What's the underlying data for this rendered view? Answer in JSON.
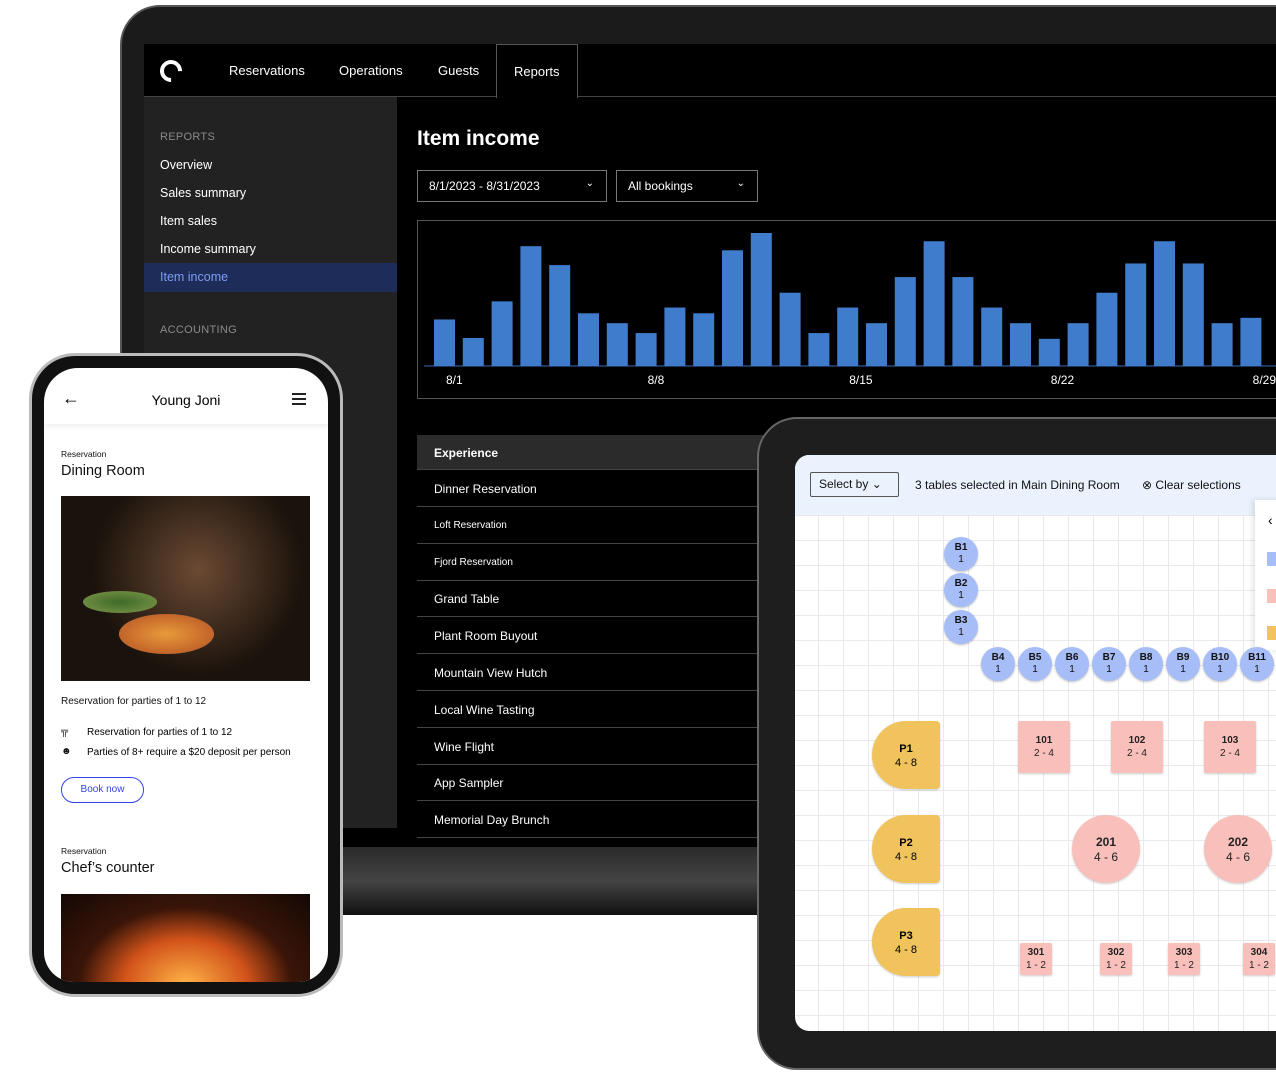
{
  "laptop": {
    "nav": {
      "logo": "logo-icon",
      "items": [
        "Reservations",
        "Operations",
        "Guests",
        "Reports"
      ],
      "active": "Reports"
    },
    "sidebar": {
      "sections": [
        {
          "heading": "REPORTS",
          "items": [
            "Overview",
            "Sales summary",
            "Item sales",
            "Income summary",
            "Item income"
          ]
        },
        {
          "heading": "ACCOUNTING",
          "items": []
        }
      ],
      "selected": "Item income",
      "selected_color": "#1e2c5a"
    },
    "page_title": "Item income",
    "date_range": "8/1/2023 - 8/31/2023",
    "booking_filter": "All bookings",
    "table": {
      "header": "Experience",
      "rows": [
        "Dinner Reservation",
        "Loft Reservation",
        "Fjord Reservation",
        "Grand Table",
        "Plant Room Buyout",
        "Mountain View Hutch",
        "Local Wine Tasting",
        "Wine Flight",
        "App Sampler",
        "Memorial Day Brunch"
      ]
    }
  },
  "chart_data": {
    "type": "bar",
    "title": "",
    "xlabel": "",
    "ylabel": "",
    "bar_color": "#3f7dcc",
    "categories": [
      "8/1",
      "8/2",
      "8/3",
      "8/4",
      "8/5",
      "8/6",
      "8/7",
      "8/8",
      "8/9",
      "8/10",
      "8/11",
      "8/12",
      "8/13",
      "8/14",
      "8/15",
      "8/16",
      "8/17",
      "8/18",
      "8/19",
      "8/20",
      "8/21",
      "8/22",
      "8/23",
      "8/24",
      "8/25",
      "8/26",
      "8/27",
      "8/28",
      "8/29"
    ],
    "tick_labels": [
      "8/1",
      "8/8",
      "8/15",
      "8/22",
      "8/29"
    ],
    "values": [
      113,
      68,
      157,
      291,
      245,
      128,
      104,
      80,
      142,
      128,
      281,
      323,
      178,
      80,
      142,
      104,
      216,
      303,
      216,
      142,
      104,
      66,
      104,
      178,
      249,
      303,
      249,
      104,
      117
    ],
    "grid": false
  },
  "tablet": {
    "select_label": "Select by",
    "status": "3 tables selected in Main Dining Room",
    "clear_label": "Clear selections",
    "bar_seats": [
      {
        "id": "B1",
        "cap": "1"
      },
      {
        "id": "B2",
        "cap": "1"
      },
      {
        "id": "B3",
        "cap": "1"
      },
      {
        "id": "B4",
        "cap": "1"
      },
      {
        "id": "B5",
        "cap": "1"
      },
      {
        "id": "B6",
        "cap": "1"
      },
      {
        "id": "B7",
        "cap": "1"
      },
      {
        "id": "B8",
        "cap": "1"
      },
      {
        "id": "B9",
        "cap": "1"
      },
      {
        "id": "B10",
        "cap": "1"
      },
      {
        "id": "B11",
        "cap": "1"
      }
    ],
    "patio": [
      {
        "id": "P1",
        "cap": "4 - 8"
      },
      {
        "id": "P2",
        "cap": "4 - 8"
      },
      {
        "id": "P3",
        "cap": "4 - 8"
      }
    ],
    "tables": [
      {
        "id": "101",
        "cap": "2 - 4"
      },
      {
        "id": "102",
        "cap": "2 - 4"
      },
      {
        "id": "103",
        "cap": "2 - 4"
      },
      {
        "id": "201",
        "cap": "4 - 6"
      },
      {
        "id": "202",
        "cap": "4 - 6"
      },
      {
        "id": "301",
        "cap": "1 - 2"
      },
      {
        "id": "302",
        "cap": "1 - 2"
      },
      {
        "id": "303",
        "cap": "1 - 2"
      },
      {
        "id": "304",
        "cap": "1 - 2"
      }
    ],
    "colors": {
      "bar": "#a7bdf8",
      "table": "#f9c0bb",
      "patio": "#f0c35c"
    }
  },
  "phone": {
    "title": "Young Joni",
    "sections": [
      {
        "label": "Reservation",
        "name": "Dining Room",
        "description": "Reservation for parties of 1 to 12",
        "details": [
          "Reservation for parties of 1 to 12",
          "Parties of 8+ require a $20 deposit per person"
        ],
        "button": "Book now"
      },
      {
        "label": "Reservation",
        "name": "Chef’s counter"
      }
    ],
    "accent": "#3344ee"
  }
}
